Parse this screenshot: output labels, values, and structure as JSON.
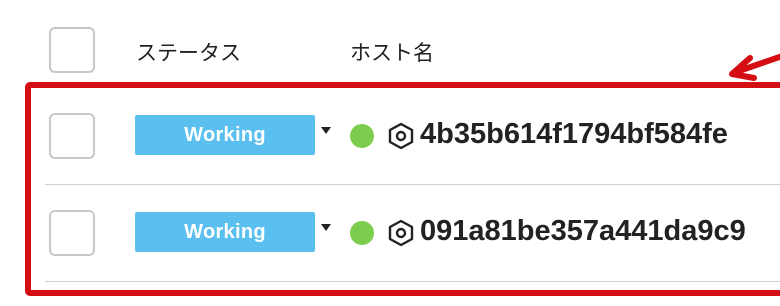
{
  "table": {
    "headers": {
      "status": "ステータス",
      "hostname": "ホスト名"
    },
    "rows": [
      {
        "status": "Working",
        "status_color": "#5bc0f0",
        "health_color": "#7ccc4e",
        "host_icon": "hexagon-icon",
        "hostname": "4b35b614f1794bf584fe"
      },
      {
        "status": "Working",
        "status_color": "#5bc0f0",
        "health_color": "#7ccc4e",
        "host_icon": "hexagon-icon",
        "hostname": "091a81be357a441da9c9"
      }
    ]
  },
  "annotation": {
    "highlight_color": "#d40d12"
  }
}
